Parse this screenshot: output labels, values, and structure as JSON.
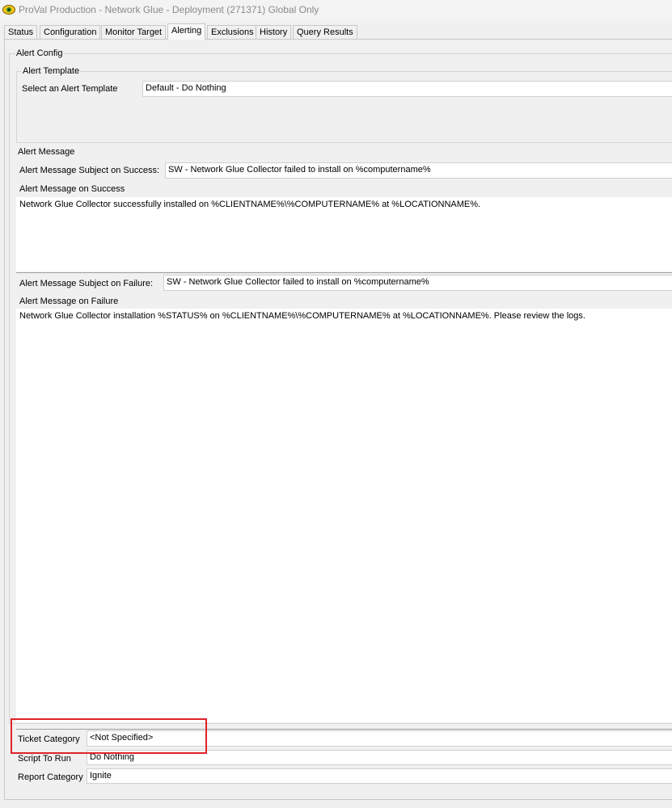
{
  "window": {
    "title": "ProVal Production - Network Glue - Deployment (271371) Global Only",
    "icon": "app-eye-icon"
  },
  "tabs": [
    "Status",
    "Configuration",
    "Monitor Target",
    "Alerting",
    "Exclusions",
    "History",
    "Query Results"
  ],
  "active_tab": "Alerting",
  "alert_config": {
    "group_label": "Alert Config",
    "template_group_label": "Alert Template",
    "select_template_label": "Select an Alert Template",
    "select_template_value": "Default - Do Nothing"
  },
  "alert_message": {
    "section_label": "Alert Message",
    "success_subject_label": "Alert Message Subject on Success:",
    "success_subject_value": "SW - Network Glue Collector failed to install on %computername%",
    "success_body_label": "Alert Message on Success",
    "success_body_value": "Network Glue Collector successfully installed on %CLIENTNAME%\\%COMPUTERNAME% at %LOCATIONNAME%.",
    "failure_subject_label": "Alert Message Subject on Failure:",
    "failure_subject_value": "SW - Network Glue Collector failed to install on %computername%",
    "failure_body_label": "Alert Message on Failure",
    "failure_body_value": "Network Glue Collector installation %STATUS% on %CLIENTNAME%\\%COMPUTERNAME% at %LOCATIONNAME%. Please review the logs."
  },
  "bottom": {
    "ticket_category_label": "Ticket Category",
    "ticket_category_value": "<Not Specified>",
    "script_label": "Script To Run",
    "script_value": "Do Nothing",
    "report_category_label": "Report Category",
    "report_category_value": "Ignite"
  },
  "highlight_color": "#e0222b"
}
